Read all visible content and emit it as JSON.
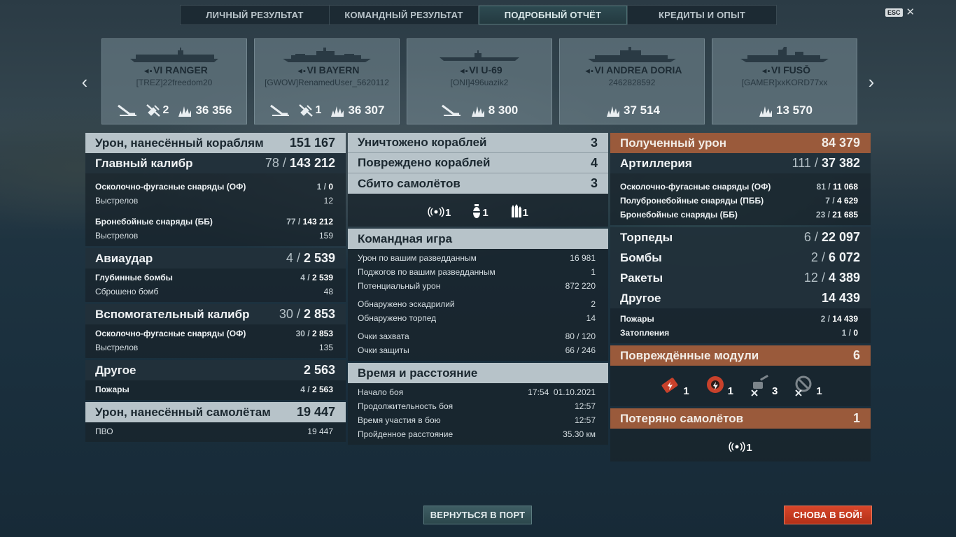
{
  "tabs": [
    "ЛИЧНЫЙ РЕЗУЛЬТАТ",
    "КОМАНДНЫЙ РЕЗУЛЬТАТ",
    "ПОДРОБНЫЙ ОТЧЁТ",
    "КРЕДИТЫ И ОПЫТ"
  ],
  "esc_label": "ESC",
  "ships": [
    {
      "tier": "VI",
      "name": "RANGER",
      "player": "[TREZ]22freedom20",
      "torp_icon": true,
      "planes": "2",
      "damage": "36 356"
    },
    {
      "tier": "VI",
      "name": "BAYERN",
      "player": "[GWOW]RenamedUser_5620112",
      "torp_icon": true,
      "planes": "1",
      "damage": "36 307"
    },
    {
      "tier": "VI",
      "name": "U-69",
      "player": "[ONI]496uazik2",
      "torp_icon": true,
      "planes": "",
      "damage": "8 300"
    },
    {
      "tier": "VI",
      "name": "ANDREA DORIA",
      "player": "2462828592",
      "torp_icon": false,
      "planes": "",
      "damage": "37 514"
    },
    {
      "tier": "VI",
      "name": "FUSŌ",
      "player": "[GAMER]xxKORD77xx",
      "torp_icon": false,
      "planes": "",
      "damage": "13 570"
    }
  ],
  "left": {
    "damage_ships": {
      "label": "Урон, нанесённый кораблям",
      "value": "151 167"
    },
    "main": {
      "label": "Главный калибр",
      "hits": "78",
      "dmg": "143 212",
      "he": {
        "label": "Осколочно-фугасные снаряды (ОФ)",
        "hits": "1",
        "dmg": "0"
      },
      "he_shots": {
        "label": "Выстрелов",
        "value": "12"
      },
      "ap": {
        "label": "Бронебойные снаряды (ББ)",
        "hits": "77",
        "dmg": "143 212"
      },
      "ap_shots": {
        "label": "Выстрелов",
        "value": "159"
      }
    },
    "air": {
      "label": "Авиаудар",
      "hits": "4",
      "dmg": "2 539",
      "depth": {
        "label": "Глубинные бомбы",
        "hits": "4",
        "dmg": "2 539"
      },
      "dropped": {
        "label": "Сброшено бомб",
        "value": "48"
      }
    },
    "sec": {
      "label": "Вспомогательный калибр",
      "hits": "30",
      "dmg": "2 853",
      "he": {
        "label": "Осколочно-фугасные снаряды (ОФ)",
        "hits": "30",
        "dmg": "2 853"
      },
      "shots": {
        "label": "Выстрелов",
        "value": "135"
      }
    },
    "other": {
      "label": "Другое",
      "value": "2 563",
      "fires": {
        "label": "Пожары",
        "hits": "4",
        "dmg": "2 563"
      }
    },
    "damage_planes": {
      "label": "Урон, нанесённый самолётам",
      "value": "19 447"
    },
    "aa": {
      "label": "ПВО",
      "value": "19 447"
    }
  },
  "mid": {
    "destroyed": {
      "label": "Уничтожено кораблей",
      "value": "3"
    },
    "damaged": {
      "label": "Повреждено кораблей",
      "value": "4"
    },
    "planes_shot": {
      "label": "Сбито самолётов",
      "value": "3"
    },
    "plane_icons": [
      {
        "icon": "fighter-icon",
        "count": "1"
      },
      {
        "icon": "bomb-icon",
        "count": "1"
      },
      {
        "icon": "rockets-icon",
        "count": "1"
      }
    ],
    "team": {
      "label": "Командная игра",
      "rows": [
        {
          "label": "Урон по вашим разведданным",
          "value": "16 981"
        },
        {
          "label": "Поджогов по вашим разведданным",
          "value": "1"
        },
        {
          "label": "Потенциальный урон",
          "value": "872 220"
        }
      ],
      "rows2": [
        {
          "label": "Обнаружено эскадрилий",
          "value": "2"
        },
        {
          "label": "Обнаружено торпед",
          "value": "14"
        }
      ],
      "rows3": [
        {
          "label": "Очки захвата",
          "value": "80 / 120"
        },
        {
          "label": "Очки защиты",
          "value": "66 / 246"
        }
      ]
    },
    "time": {
      "label": "Время и расстояние",
      "rows": [
        {
          "label": "Начало боя",
          "value": "17:54  01.10.2021"
        },
        {
          "label": "Продолжительность боя",
          "value": "12:57"
        },
        {
          "label": "Время участия в бою",
          "value": "12:57"
        },
        {
          "label": "Пройденное расстояние",
          "value": "35.30 км"
        }
      ]
    }
  },
  "right": {
    "received": {
      "label": "Полученный урон",
      "value": "84 379"
    },
    "art": {
      "label": "Артиллерия",
      "hits": "111",
      "dmg": "37 382",
      "he": {
        "label": "Осколочно-фугасные снаряды (ОФ)",
        "hits": "81",
        "dmg": "11 068"
      },
      "sap": {
        "label": "Полубронебойные снаряды (ПББ)",
        "hits": "7",
        "dmg": "4 629"
      },
      "ap": {
        "label": "Бронебойные снаряды (ББ)",
        "hits": "23",
        "dmg": "21 685"
      }
    },
    "torp": {
      "label": "Торпеды",
      "hits": "6",
      "dmg": "22 097"
    },
    "bombs": {
      "label": "Бомбы",
      "hits": "2",
      "dmg": "6 072"
    },
    "rockets": {
      "label": "Ракеты",
      "hits": "12",
      "dmg": "4 389"
    },
    "other": {
      "label": "Другое",
      "value": "14 439",
      "fires": {
        "label": "Пожары",
        "hits": "2",
        "dmg": "14 439"
      },
      "flood": {
        "label": "Затопления",
        "hits": "1",
        "dmg": "0"
      }
    },
    "modules": {
      "label": "Повреждённые модули",
      "value": "6",
      "items": [
        {
          "icon": "engine-damaged-icon",
          "count": "1"
        },
        {
          "icon": "steering-damaged-icon",
          "count": "1"
        },
        {
          "icon": "turret-destroyed-icon",
          "count": "3"
        },
        {
          "icon": "aa-destroyed-icon",
          "count": "1"
        }
      ]
    },
    "lost": {
      "label": "Потеряно самолётов",
      "value": "1",
      "items": [
        {
          "icon": "fighter-icon",
          "count": "1"
        }
      ]
    }
  },
  "buttons": {
    "port": "ВЕРНУТЬСЯ В ПОРТ",
    "battle": "СНОВА В БОЙ!"
  }
}
